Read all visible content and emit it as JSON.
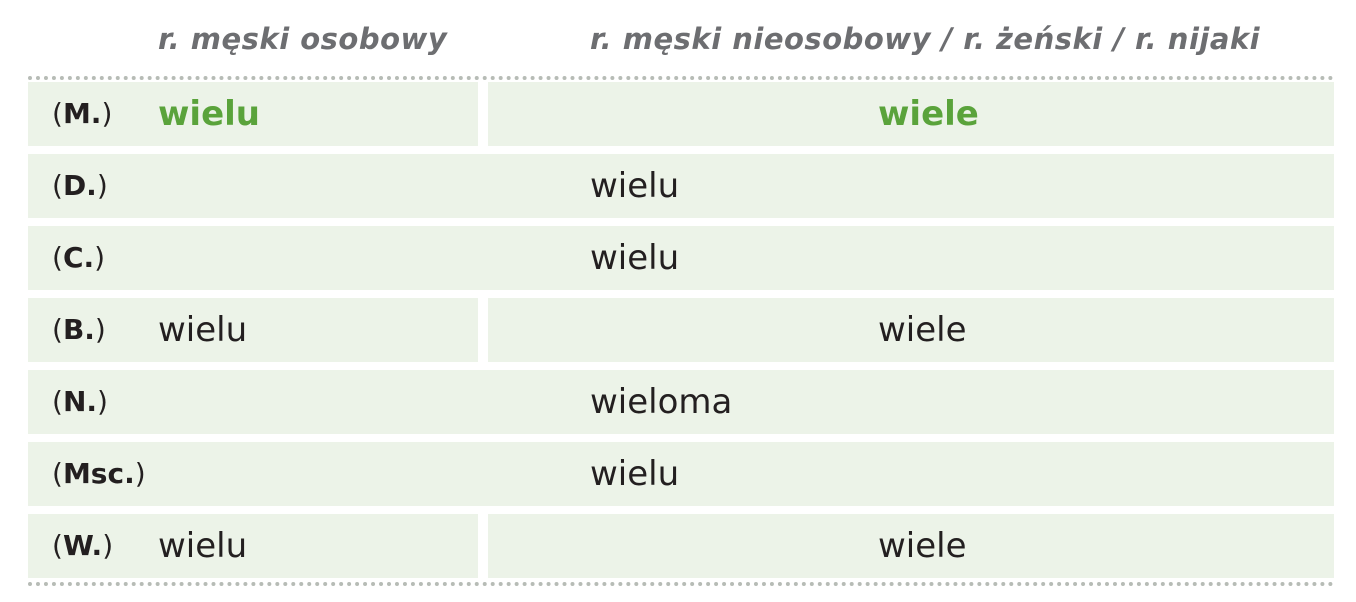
{
  "header": {
    "col_masc_personal": "r. męski osobowy",
    "col_other": "r. męski nieosobowy / r. żeński / r. nijaki"
  },
  "rows": [
    {
      "case_open": "(",
      "case": "M.",
      "case_close": ")",
      "masc_personal": "wielu",
      "other": "wiele"
    },
    {
      "case_open": "(",
      "case": "D.",
      "case_close": ")",
      "all": "wielu"
    },
    {
      "case_open": "(",
      "case": "C.",
      "case_close": ")",
      "all": "wielu"
    },
    {
      "case_open": "(",
      "case": "B.",
      "case_close": ")",
      "masc_personal": "wielu",
      "other": "wiele"
    },
    {
      "case_open": "(",
      "case": "N.",
      "case_close": ")",
      "all": "wieloma"
    },
    {
      "case_open": "(",
      "case": "Msc.",
      "case_close": ")",
      "all": "wielu"
    },
    {
      "case_open": "(",
      "case": "W.",
      "case_close": ")",
      "masc_personal": "wielu",
      "other": "wiele"
    }
  ],
  "colors": {
    "highlight": "#5aa33b",
    "cell_background": "#ecf3e8",
    "header_text": "#6d6e71"
  }
}
